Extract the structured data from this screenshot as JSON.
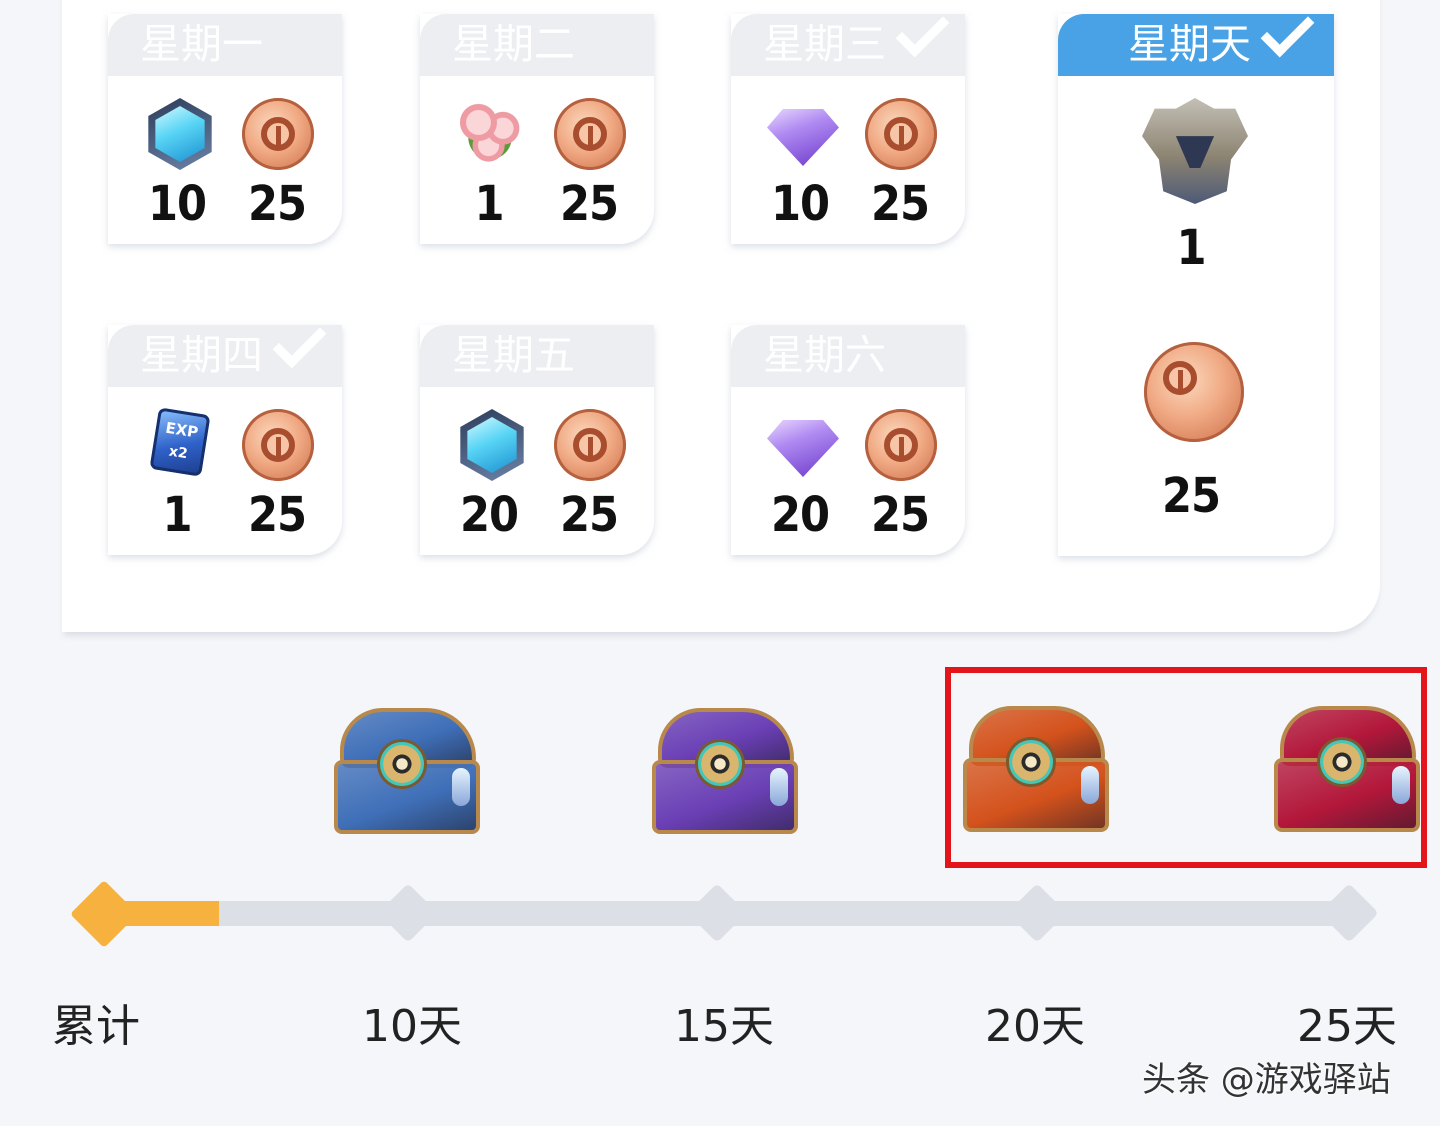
{
  "days": [
    {
      "label": "星期一",
      "checked": false,
      "rewards": [
        {
          "icon": "blue-hexagon-gem-icon",
          "value": "10"
        },
        {
          "icon": "bronze-coin-icon",
          "value": "25"
        }
      ]
    },
    {
      "label": "星期二",
      "checked": false,
      "rewards": [
        {
          "icon": "rose-bouquet-icon",
          "value": "1"
        },
        {
          "icon": "bronze-coin-icon",
          "value": "25"
        }
      ]
    },
    {
      "label": "星期三",
      "checked": true,
      "rewards": [
        {
          "icon": "purple-diamond-icon",
          "value": "10"
        },
        {
          "icon": "bronze-coin-icon",
          "value": "25"
        }
      ]
    },
    {
      "label": "星期四",
      "checked": true,
      "rewards": [
        {
          "icon": "exp-double-card-icon",
          "value": "1",
          "card_text": "EXP",
          "card_multiplier": "x2"
        },
        {
          "icon": "bronze-coin-icon",
          "value": "25"
        }
      ]
    },
    {
      "label": "星期五",
      "checked": false,
      "rewards": [
        {
          "icon": "blue-hexagon-gem-icon",
          "value": "20"
        },
        {
          "icon": "bronze-coin-icon",
          "value": "25"
        }
      ]
    },
    {
      "label": "星期六",
      "checked": false,
      "rewards": [
        {
          "icon": "purple-diamond-icon",
          "value": "20"
        },
        {
          "icon": "bronze-coin-icon",
          "value": "25"
        }
      ]
    },
    {
      "label": "星期天",
      "checked": true,
      "active": true,
      "rewards": [
        {
          "icon": "helmet-puzzle-fragment-icon",
          "value": "1"
        },
        {
          "icon": "bronze-coin-icon",
          "value": "25"
        }
      ]
    }
  ],
  "cumulative": {
    "label": "累计",
    "progress_fraction": 0.04,
    "milestones": [
      {
        "label": "10天",
        "chest": "blue-treasure-chest-icon",
        "color": "#3f6fb8"
      },
      {
        "label": "15天",
        "chest": "purple-treasure-chest-icon",
        "color": "#6a3fb5"
      },
      {
        "label": "20天",
        "chest": "orange-treasure-chest-icon",
        "color": "#d4521c"
      },
      {
        "label": "25天",
        "chest": "red-treasure-chest-icon",
        "color": "#b3173a"
      }
    ]
  },
  "watermark": "头条 @游戏驿站",
  "colors": {
    "accent": "#4aa2e6",
    "progress": "#f7b13f",
    "highlight": "#e4141b",
    "inactive_header": "#eceef2"
  }
}
